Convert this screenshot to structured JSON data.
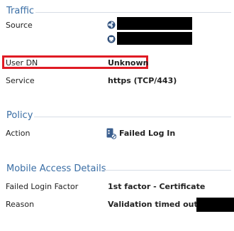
{
  "traffic": {
    "title": "Traffic",
    "source_label": "Source",
    "user_dn_label": "User DN",
    "user_dn_value": "Unknown",
    "service_label": "Service",
    "service_value": "https (TCP/443)"
  },
  "policy": {
    "title": "Policy",
    "action_label": "Action",
    "action_value": "Failed Log In"
  },
  "mobile_access": {
    "title": "Mobile Access Details",
    "failed_login_factor_label": "Failed Login Factor",
    "failed_login_factor_value": "1st factor - Certificate",
    "reason_label": "Reason",
    "reason_value": "Validation timed out.CN"
  },
  "icons": {
    "source_network": "globe-icon",
    "source_host": "computer-icon",
    "action": "failed-login-icon"
  },
  "colors": {
    "section_title": "#3a6ea5",
    "highlight": "#e01b24",
    "redaction": "#000000"
  }
}
